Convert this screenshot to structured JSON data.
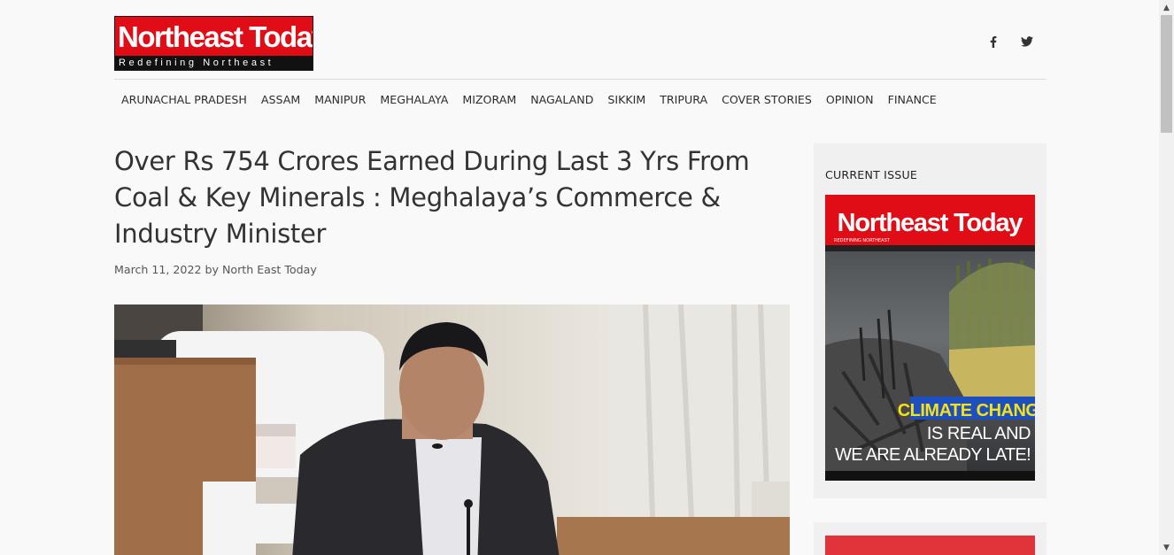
{
  "brand": {
    "logo_title": "Northeast Today",
    "logo_tagline": "Redefining Northeast",
    "color_red": "#e00d17",
    "color_black": "#111111"
  },
  "social": [
    {
      "icon": "facebook-icon"
    },
    {
      "icon": "twitter-icon"
    }
  ],
  "nav": [
    "ARUNACHAL PRADESH",
    "ASSAM",
    "MANIPUR",
    "MEGHALAYA",
    "MIZORAM",
    "NAGALAND",
    "SIKKIM",
    "TRIPURA",
    "COVER STORIES",
    "OPINION",
    "FINANCE"
  ],
  "article": {
    "title": "Over Rs 754 Crores Earned During Last 3 Yrs From Coal & Key Minerals : Meghalaya’s Commerce & Industry Minister",
    "date": "March 11, 2022",
    "by": "by",
    "author": "North East Today"
  },
  "sidebar": {
    "current_issue_title": "CURRENT ISSUE",
    "cover": {
      "masthead": "Northeast Today",
      "masthead_tagline": "REDEFINING NORTHEAST",
      "headline_1": "CLIMATE CHANGE",
      "headline_2": "IS REAL AND",
      "headline_3": "WE ARE ALREADY LATE!"
    }
  }
}
